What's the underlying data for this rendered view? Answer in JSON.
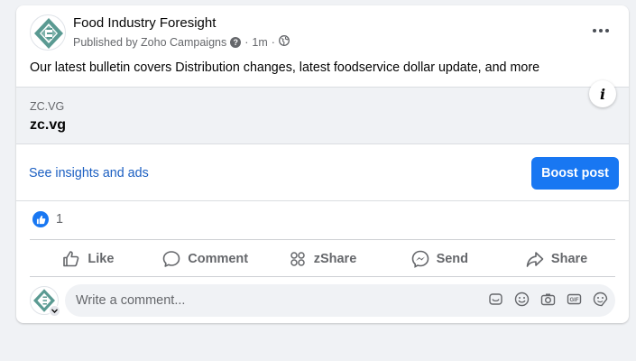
{
  "post": {
    "page_name": "Food Industry Foresight",
    "published_by": "Published by Zoho Campaigns",
    "time": "1m",
    "separator": "·",
    "text": "Our latest bulletin covers Distribution changes, latest foodservice dollar update,  and more"
  },
  "link_preview": {
    "domain": "ZC.VG",
    "title": "zc.vg"
  },
  "insights": {
    "link_label": "See insights and ads",
    "boost_label": "Boost post"
  },
  "reactions": {
    "count": "1"
  },
  "actions": {
    "like": "Like",
    "comment": "Comment",
    "zshare": "zShare",
    "send": "Send",
    "share": "Share"
  },
  "comment": {
    "placeholder": "Write a comment..."
  },
  "colors": {
    "accent": "#1877f2",
    "link": "#1b5fc2",
    "muted_text": "#65676b",
    "background": "#f0f2f5",
    "logo_teal": "#5a9a92"
  },
  "icons": [
    "more-options-icon",
    "help-icon",
    "globe-icon",
    "info-icon",
    "like-reaction-icon",
    "thumbs-up-icon",
    "comment-icon",
    "zshare-icon",
    "messenger-icon",
    "share-icon",
    "sticker-icon",
    "emoji-icon",
    "camera-icon",
    "gif-icon",
    "avatar-sticker-icon",
    "chevron-down-icon"
  ]
}
